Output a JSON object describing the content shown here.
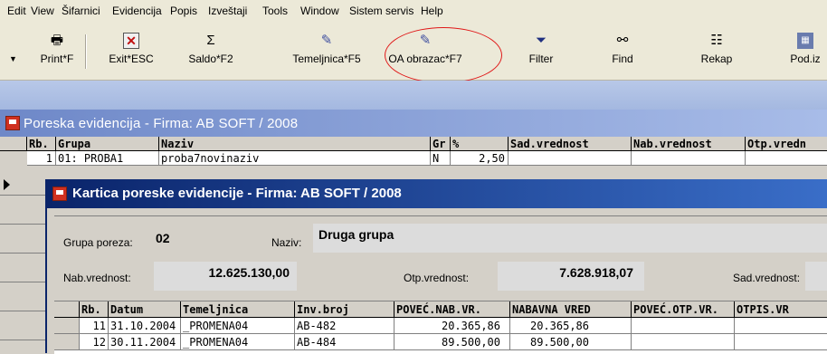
{
  "menu": [
    "Edit",
    "View",
    "Šifarnici",
    "Evidencija",
    "Popis",
    "Izveštaji",
    "Tools",
    "Window",
    "Sistem servis",
    "Help"
  ],
  "toolbar": {
    "print": "Print*F",
    "exit": "Exit*ESC",
    "saldo": "Saldo*F2",
    "temeljnica": "Temeljnica*F5",
    "oa_obrazac": "OA obrazac*F7",
    "filter": "Filter",
    "find": "Find",
    "rekap": "Rekap",
    "pod": "Pod.iz"
  },
  "icons": {
    "print": "printer-icon",
    "exit": "exit-icon",
    "saldo": "sigma-icon",
    "temeljnica": "document-edit-icon",
    "oa_obrazac": "document-edit-icon",
    "filter": "filter-icon",
    "find": "binoculars-icon",
    "rekap": "summary-icon",
    "pod": "data-icon"
  },
  "colors": {
    "annotation_circle": "#e01818",
    "active_title": "#0a246a",
    "inactive_title": "#6e88c8"
  },
  "poreska": {
    "title": "Poreska evidencija   - Firma:  AB SOFT / 2008",
    "columns": [
      "Rb.",
      "Grupa",
      "Naziv",
      "Gr",
      "%",
      "Sad.vrednost",
      "Nab.vrednost",
      "Otp.vredn"
    ],
    "rows": [
      {
        "rb": "1",
        "grupa": "01: PROBA1",
        "naziv": "proba7novinaziv",
        "gr": "N",
        "pct": "2,50",
        "sad": "",
        "nab": "",
        "otp": ""
      }
    ]
  },
  "kartica": {
    "title": "Kartica poreske evidencije    - Firma:  AB SOFT / 2008",
    "grupa_label": "Grupa poreza:",
    "grupa_value": "02",
    "naziv_label": "Naziv:",
    "naziv_value": "Druga grupa",
    "nab_label": "Nab.vrednost:",
    "nab_value": "12.625.130,00",
    "otp_label": "Otp.vrednost:",
    "otp_value": "7.628.918,07",
    "sad_label": "Sad.vrednost:",
    "columns": [
      "Rb.",
      "Datum",
      "Temeljnica",
      "Inv.broj",
      "POVEĆ.NAB.VR.",
      "NABAVNA VRED",
      "POVEĆ.OTP.VR.",
      "OTPIS.VR"
    ],
    "rows": [
      {
        "rb": "11",
        "datum": "31.10.2004",
        "temeljnica": "_PROMENA04",
        "inv": "AB-482",
        "povec": "20.365,86",
        "nabavna": "20.365,86",
        "povotp": "",
        "otpis": ""
      },
      {
        "rb": "12",
        "datum": "30.11.2004",
        "temeljnica": "_PROMENA04",
        "inv": "AB-484",
        "povec": "89.500,00",
        "nabavna": "89.500,00",
        "povotp": "",
        "otpis": ""
      }
    ]
  }
}
